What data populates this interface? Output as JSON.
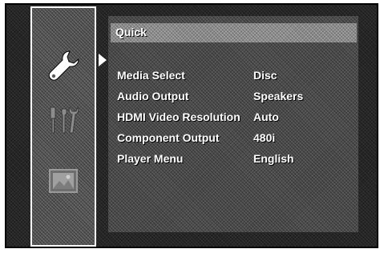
{
  "sidebar": {
    "icons": [
      {
        "name": "wrench-icon",
        "selected": true
      },
      {
        "name": "tools-icon",
        "selected": false
      },
      {
        "name": "picture-icon",
        "selected": false
      }
    ]
  },
  "panel": {
    "title": "Quick"
  },
  "menu": {
    "items": [
      {
        "label": "Media Select",
        "value": "Disc"
      },
      {
        "label": "Audio Output",
        "value": "Speakers"
      },
      {
        "label": "HDMI Video Resolution",
        "value": "Auto"
      },
      {
        "label": "Component Output",
        "value": "480i"
      },
      {
        "label": "Player Menu",
        "value": "English"
      }
    ]
  },
  "colors": {
    "frame": "#1e1e1e",
    "panel": "#4d4d4d",
    "title_bar": "#8a8a8a",
    "text": "#ffffff"
  }
}
